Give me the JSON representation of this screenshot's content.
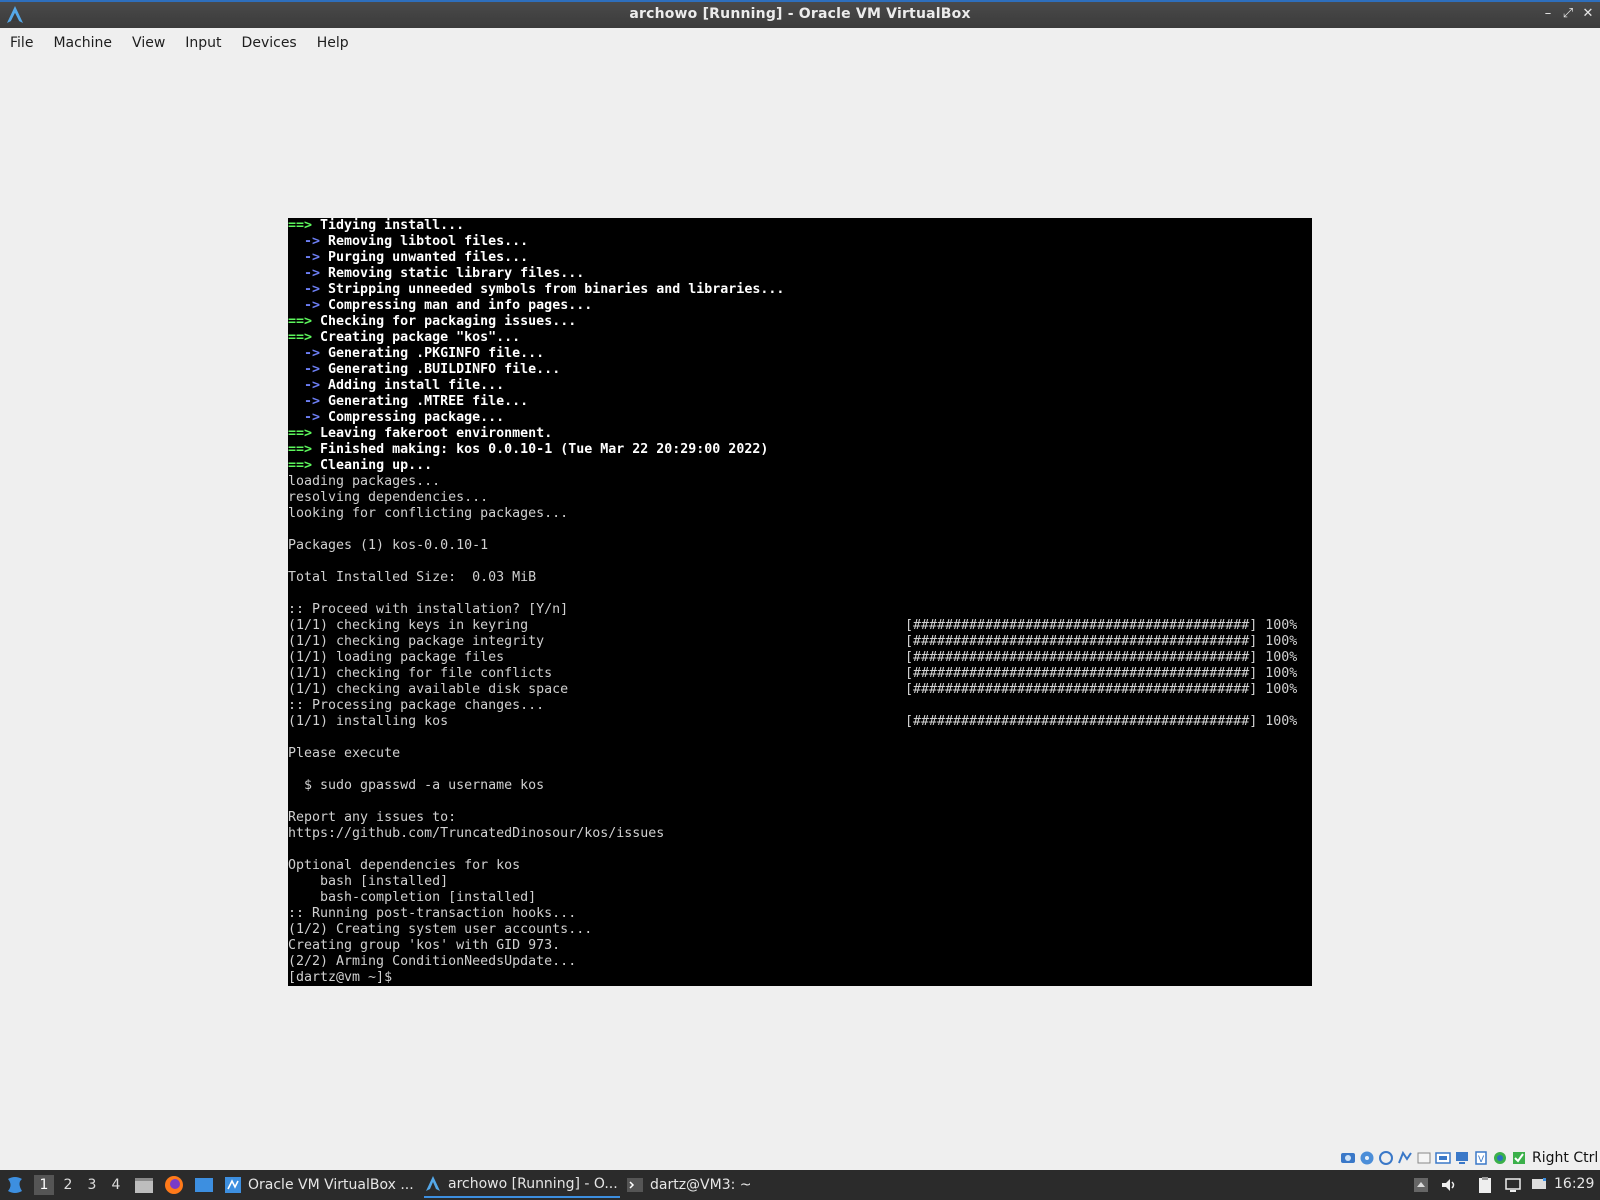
{
  "window": {
    "title": "archowo [Running] - Oracle VM VirtualBox",
    "controls": {
      "minimize": "–",
      "restore": "⤢",
      "close": "✕"
    }
  },
  "menubar": {
    "items": [
      "File",
      "Machine",
      "View",
      "Input",
      "Devices",
      "Help"
    ]
  },
  "terminal": {
    "lines": [
      {
        "p": "==>",
        "c": "g",
        "t": " Tidying install...",
        "b": true
      },
      {
        "p": "  ->",
        "c": "b",
        "t": " Removing libtool files...",
        "b": true
      },
      {
        "p": "  ->",
        "c": "b",
        "t": " Purging unwanted files...",
        "b": true
      },
      {
        "p": "  ->",
        "c": "b",
        "t": " Removing static library files...",
        "b": true
      },
      {
        "p": "  ->",
        "c": "b",
        "t": " Stripping unneeded symbols from binaries and libraries...",
        "b": true
      },
      {
        "p": "  ->",
        "c": "b",
        "t": " Compressing man and info pages...",
        "b": true
      },
      {
        "p": "==>",
        "c": "g",
        "t": " Checking for packaging issues...",
        "b": true
      },
      {
        "p": "==>",
        "c": "g",
        "t": " Creating package \"kos\"...",
        "b": true
      },
      {
        "p": "  ->",
        "c": "b",
        "t": " Generating .PKGINFO file...",
        "b": true
      },
      {
        "p": "  ->",
        "c": "b",
        "t": " Generating .BUILDINFO file...",
        "b": true
      },
      {
        "p": "  ->",
        "c": "b",
        "t": " Adding install file...",
        "b": true
      },
      {
        "p": "  ->",
        "c": "b",
        "t": " Generating .MTREE file...",
        "b": true
      },
      {
        "p": "  ->",
        "c": "b",
        "t": " Compressing package...",
        "b": true
      },
      {
        "p": "==>",
        "c": "g",
        "t": " Leaving fakeroot environment.",
        "b": true
      },
      {
        "p": "==>",
        "c": "g",
        "t": " Finished making: kos 0.0.10-1 (Tue Mar 22 20:29:00 2022)",
        "b": true
      },
      {
        "p": "==>",
        "c": "g",
        "t": " Cleaning up...",
        "b": true
      },
      {
        "p": "",
        "c": "",
        "t": "loading packages...",
        "b": false
      },
      {
        "p": "",
        "c": "",
        "t": "resolving dependencies...",
        "b": false
      },
      {
        "p": "",
        "c": "",
        "t": "looking for conflicting packages...",
        "b": false
      },
      {
        "p": "",
        "c": "",
        "t": "",
        "b": false
      },
      {
        "p": "",
        "c": "",
        "t": "Packages (1) kos-0.0.10-1",
        "b": false
      },
      {
        "p": "",
        "c": "",
        "t": "",
        "b": false
      },
      {
        "p": "",
        "c": "",
        "t": "Total Installed Size:  0.03 MiB",
        "b": false
      },
      {
        "p": "",
        "c": "",
        "t": "",
        "b": false
      },
      {
        "p": "",
        "c": "",
        "t": ":: Proceed with installation? [Y/n]",
        "b": false
      },
      {
        "p": "",
        "c": "",
        "t": "(1/1) checking keys in keyring",
        "b": false,
        "r": "[##########################################] 100%"
      },
      {
        "p": "",
        "c": "",
        "t": "(1/1) checking package integrity",
        "b": false,
        "r": "[##########################################] 100%"
      },
      {
        "p": "",
        "c": "",
        "t": "(1/1) loading package files",
        "b": false,
        "r": "[##########################################] 100%"
      },
      {
        "p": "",
        "c": "",
        "t": "(1/1) checking for file conflicts",
        "b": false,
        "r": "[##########################################] 100%"
      },
      {
        "p": "",
        "c": "",
        "t": "(1/1) checking available disk space",
        "b": false,
        "r": "[##########################################] 100%"
      },
      {
        "p": "",
        "c": "",
        "t": ":: Processing package changes...",
        "b": false
      },
      {
        "p": "",
        "c": "",
        "t": "(1/1) installing kos",
        "b": false,
        "r": "[##########################################] 100%"
      },
      {
        "p": "",
        "c": "",
        "t": "",
        "b": false
      },
      {
        "p": "",
        "c": "",
        "t": "Please execute",
        "b": false
      },
      {
        "p": "",
        "c": "",
        "t": "",
        "b": false
      },
      {
        "p": "",
        "c": "",
        "t": "  $ sudo gpasswd -a username kos",
        "b": false
      },
      {
        "p": "",
        "c": "",
        "t": "",
        "b": false
      },
      {
        "p": "",
        "c": "",
        "t": "Report any issues to:",
        "b": false
      },
      {
        "p": "",
        "c": "",
        "t": "https://github.com/TruncatedDinosour/kos/issues",
        "b": false
      },
      {
        "p": "",
        "c": "",
        "t": "",
        "b": false
      },
      {
        "p": "",
        "c": "",
        "t": "Optional dependencies for kos",
        "b": false
      },
      {
        "p": "",
        "c": "",
        "t": "    bash [installed]",
        "b": false
      },
      {
        "p": "",
        "c": "",
        "t": "    bash-completion [installed]",
        "b": false
      },
      {
        "p": "",
        "c": "",
        "t": ":: Running post-transaction hooks...",
        "b": false
      },
      {
        "p": "",
        "c": "",
        "t": "(1/2) Creating system user accounts...",
        "b": false
      },
      {
        "p": "",
        "c": "",
        "t": "Creating group 'kos' with GID 973.",
        "b": false
      },
      {
        "p": "",
        "c": "",
        "t": "(2/2) Arming ConditionNeedsUpdate...",
        "b": false
      },
      {
        "p": "",
        "c": "",
        "t": "[dartz@vm ~]$",
        "b": false
      }
    ]
  },
  "status_bar": {
    "host_key": "Right Ctrl",
    "icons": [
      "hard-disk-icon",
      "optical-drive-icon",
      "audio-icon",
      "network-icon",
      "usb-icon",
      "shared-folders-icon",
      "display-icon",
      "recording-icon",
      "cpu-icon",
      "virtualization-icon",
      "mouse-integration-icon"
    ]
  },
  "taskbar": {
    "workspaces": [
      "1",
      "2",
      "3",
      "4"
    ],
    "active_workspace": "1",
    "tasks": [
      {
        "label": "Oracle VM VirtualBox ...",
        "icon": "virtualbox-icon"
      },
      {
        "label": "archowo [Running] - O...",
        "icon": "archlinux-icon"
      },
      {
        "label": "dartz@VM3: ~",
        "icon": "terminal-icon"
      }
    ],
    "clock": "16:29"
  },
  "colors": {
    "accent": "#3d8fe0",
    "arrow_green": "#5df75d",
    "arrow_blue": "#6d7ff5",
    "taskbar_bg": "#2b2b2b",
    "window_bg": "#efefef"
  }
}
